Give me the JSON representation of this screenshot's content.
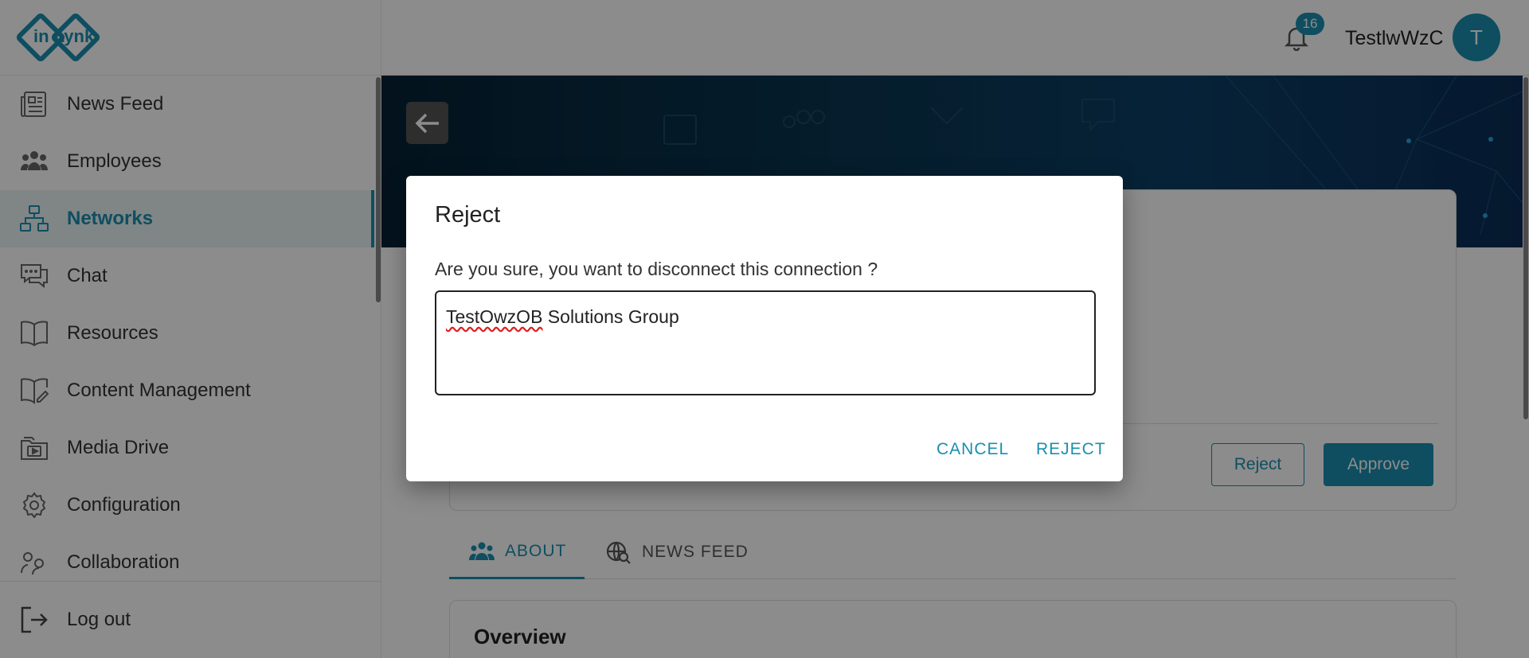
{
  "app": {
    "logo_text": "in Lynk",
    "brand_color": "#1b8fb0"
  },
  "sidebar": {
    "items": [
      {
        "label": "News Feed",
        "icon": "newspaper-icon"
      },
      {
        "label": "Employees",
        "icon": "people-icon"
      },
      {
        "label": "Networks",
        "icon": "network-icon",
        "active": true
      },
      {
        "label": "Chat",
        "icon": "chat-icon"
      },
      {
        "label": "Resources",
        "icon": "book-icon"
      },
      {
        "label": "Content Management",
        "icon": "edit-book-icon"
      },
      {
        "label": "Media Drive",
        "icon": "media-folder-icon"
      },
      {
        "label": "Configuration",
        "icon": "gear-icon"
      },
      {
        "label": "Collaboration",
        "icon": "collaboration-icon"
      }
    ],
    "logout_label": "Log out"
  },
  "topbar": {
    "notification_count": "16",
    "username": "TestlwWzC",
    "avatar_initial": "T"
  },
  "card": {
    "reject_label": "Reject",
    "approve_label": "Approve"
  },
  "tabs": [
    {
      "label": "ABOUT",
      "active": true
    },
    {
      "label": "NEWS FEED",
      "active": false
    }
  ],
  "overview_title": "Overview",
  "dialog": {
    "title": "Reject",
    "message": "Are you sure, you want to disconnect this connection ?",
    "input_word1": "TestOwzOB",
    "input_rest": " Solutions Group",
    "cancel_label": "CANCEL",
    "reject_label": "REJECT"
  }
}
